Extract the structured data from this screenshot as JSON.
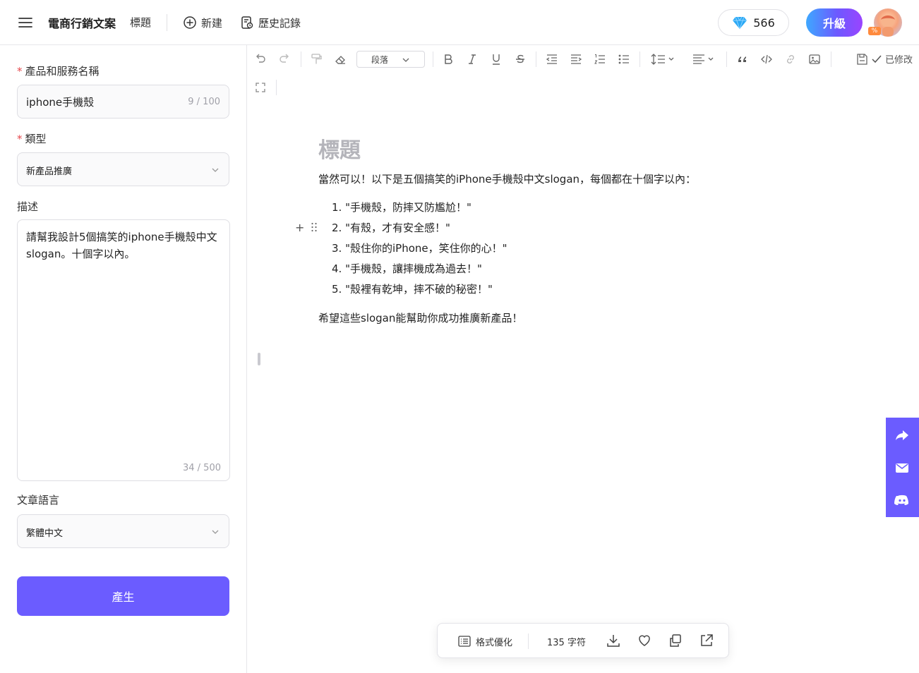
{
  "header": {
    "app_title": "電商行銷文案",
    "doc_title": "標題",
    "new_label": "新建",
    "history_label": "歷史記錄",
    "credits": "566",
    "upgrade_label": "升級",
    "avatar_badge": "%"
  },
  "form": {
    "product": {
      "label": "產品和服務名稱",
      "value": "iphone手機殼",
      "counter": "9 / 100"
    },
    "type": {
      "label": "類型",
      "value": "新產品推廣"
    },
    "description": {
      "label": "描述",
      "value": "請幫我設計5個搞笑的iphone手機殼中文slogan。十個字以內。",
      "counter": "34 / 500"
    },
    "language": {
      "label": "文章語言",
      "value": "繁體中文"
    },
    "generate_label": "產生"
  },
  "toolbar": {
    "paragraph_label": "段落",
    "saved_label": "已修改"
  },
  "document": {
    "heading": "標題",
    "intro": "當然可以！以下是五個搞笑的iPhone手機殼中文slogan，每個都在十個字以內：",
    "items": [
      "1. \"手機殼，防摔又防尷尬！\"",
      "2. \"有殼，才有安全感！\"",
      "3. \"殼住你的iPhone，笑住你的心！\"",
      "4. \"手機殼，讓摔機成為過去！\"",
      "5. \"殼裡有乾坤，摔不破的秘密！\""
    ],
    "outro": "希望這些slogan能幫助你成功推廣新產品！"
  },
  "bottom_bar": {
    "format_label": "格式優化",
    "char_count": "135 字符"
  },
  "colors": {
    "accent": "#6b5cff",
    "required": "#e5484d",
    "heading_gray": "#b4b4ba"
  }
}
